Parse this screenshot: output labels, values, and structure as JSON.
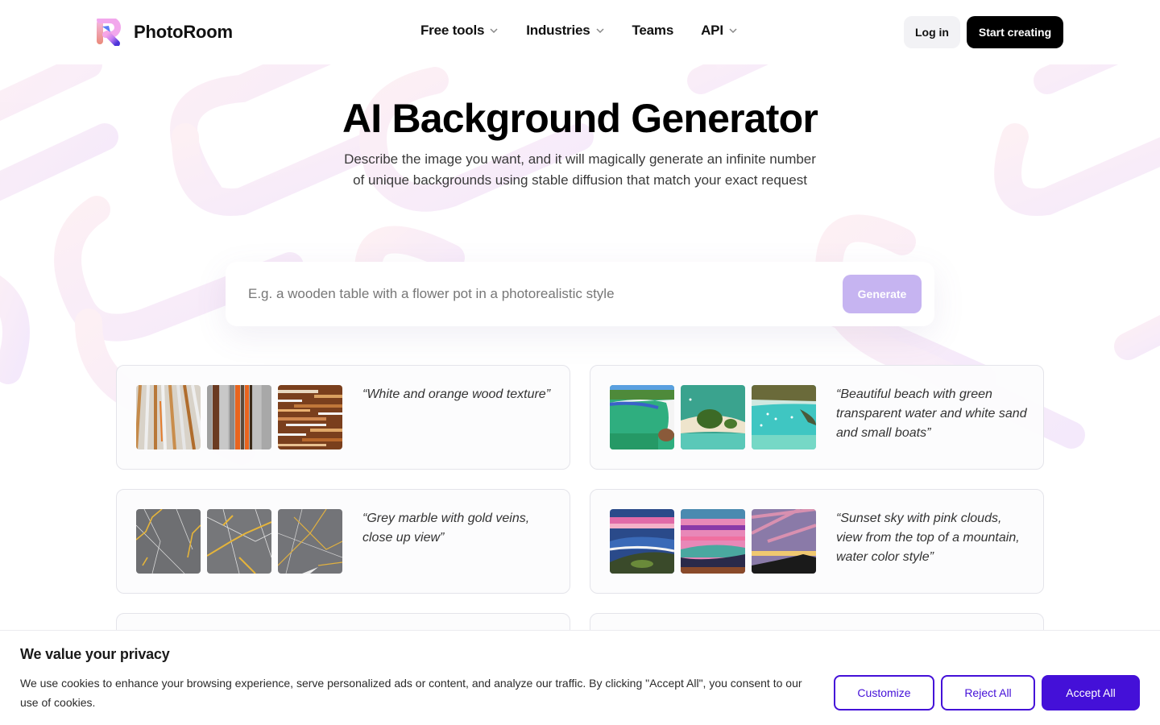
{
  "brand": {
    "name": "PhotoRoom",
    "accent_color": "#4410d8",
    "generate_color": "#c6b4f1"
  },
  "nav": {
    "links": [
      {
        "label": "Free tools",
        "has_dropdown": true
      },
      {
        "label": "Industries",
        "has_dropdown": true
      },
      {
        "label": "Teams",
        "has_dropdown": false
      },
      {
        "label": "API",
        "has_dropdown": true
      }
    ],
    "login_label": "Log in",
    "start_label": "Start creating"
  },
  "hero": {
    "title": "AI Background Generator",
    "subtitle": "Describe the image you want, and it will magically generate an infinite number of unique backgrounds using stable diffusion that match your exact request"
  },
  "prompt": {
    "value": "",
    "placeholder": "E.g. a wooden table with a flower pot in a photorealistic style",
    "generate_label": "Generate"
  },
  "examples": [
    {
      "caption": "“White and orange wood texture”",
      "theme": "wood",
      "thumb_icons": [
        "wood-texture-image",
        "wood-texture-image",
        "wood-texture-image"
      ]
    },
    {
      "caption": "“Beautiful beach with green transparent water and white sand and small boats”",
      "theme": "beach",
      "thumb_icons": [
        "beach-image",
        "beach-image",
        "beach-image"
      ]
    },
    {
      "caption": "“Grey marble with gold veins, close up view”",
      "theme": "marble",
      "thumb_icons": [
        "marble-image",
        "marble-image",
        "marble-image"
      ]
    },
    {
      "caption": "“Sunset sky with pink clouds, view from the top of a mountain, water color style”",
      "theme": "sunset",
      "thumb_icons": [
        "sunset-image",
        "sunset-image",
        "sunset-image"
      ]
    },
    {
      "caption": "",
      "theme": "partial"
    },
    {
      "caption": "",
      "theme": "partial"
    }
  ],
  "cookie": {
    "title": "We value your privacy",
    "text": "We use cookies to enhance your browsing experience, serve personalized ads or content, and analyze our traffic. By clicking \"Accept All\", you consent to our use of cookies.",
    "customize_label": "Customize",
    "reject_label": "Reject All",
    "accept_label": "Accept All"
  }
}
